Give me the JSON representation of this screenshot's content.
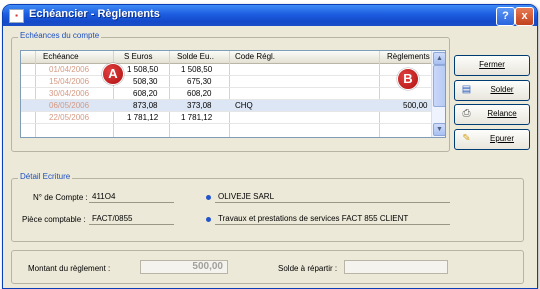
{
  "window": {
    "title": "Echéancier - Règlements"
  },
  "titlebar_buttons": {
    "help": "?",
    "close": "x"
  },
  "group_echeances": {
    "label": "Echéances du compte"
  },
  "table": {
    "headers": [
      "Echéance",
      "S Euros",
      "Solde Eu..",
      "Code Régl.",
      "Règlements"
    ],
    "rows": [
      {
        "echeance": "01/04/2006",
        "montant": "1 508,50",
        "solde": "1 508,50",
        "code": "",
        "reglement": ""
      },
      {
        "echeance": "15/04/2006",
        "montant": "508,30",
        "solde": "675,30",
        "code": "",
        "reglement": ""
      },
      {
        "echeance": "30/04/2006",
        "montant": "608,20",
        "solde": "608,20",
        "code": "",
        "reglement": ""
      },
      {
        "echeance": "06/05/2006",
        "montant": "873,08",
        "solde": "373,08",
        "code": "CHQ",
        "reglement": "500,00"
      },
      {
        "echeance": "22/05/2006",
        "montant": "1 781,12",
        "solde": "1 781,12",
        "code": "",
        "reglement": ""
      }
    ]
  },
  "badges": {
    "a": "A",
    "b": "B"
  },
  "buttons": {
    "fermer": "Fermer",
    "solder": "Solder",
    "relance": "Relance",
    "epurer": "Epurer"
  },
  "detail": {
    "label": "Détail Ecriture",
    "compte_label": "N° de Compte :",
    "compte_value": "411O4",
    "compte_name": "OLIVEJE SARL",
    "piece_label": "Pièce comptable :",
    "piece_value": "FACT/0855",
    "piece_desc": "Travaux et prestations de services FACT 855 CLIENT"
  },
  "footer": {
    "montant_label": "Montant du règlement :",
    "montant_value": "500,00",
    "solde_label": "Solde à répartir :",
    "solde_value": ""
  },
  "colors": {
    "accent": "#1c5ce0",
    "badge": "#c41818",
    "date_text": "#d49a84"
  }
}
